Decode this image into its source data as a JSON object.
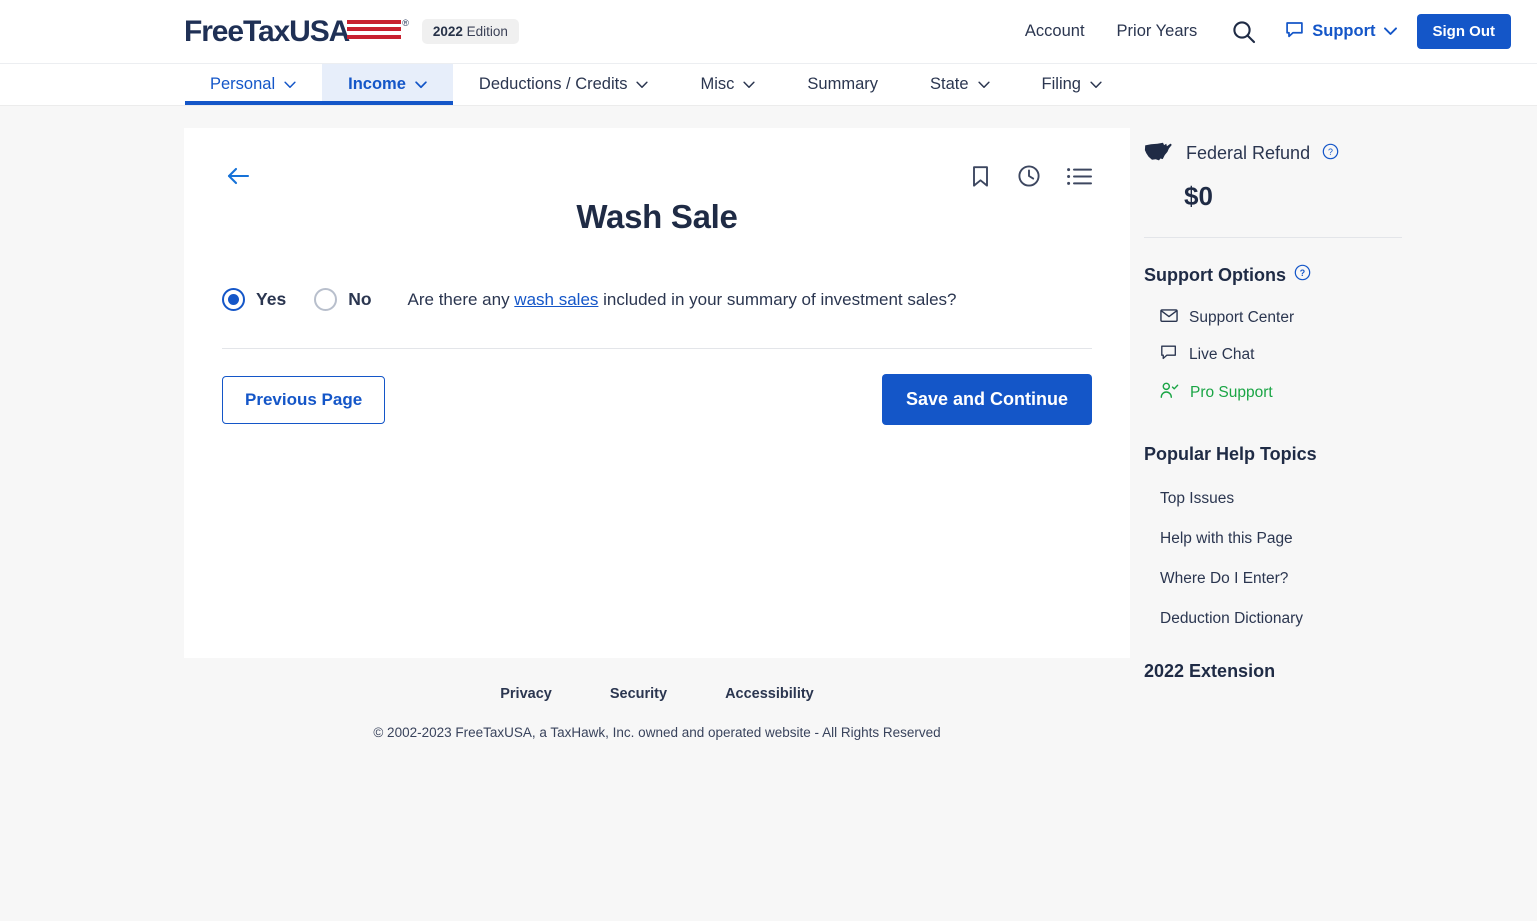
{
  "brand": {
    "name": "FreeTaxUSA",
    "registered_mark": "®",
    "edition_year": "2022",
    "edition_label": "Edition",
    "flag_color": "#c8202f",
    "logo_color": "#1f3055"
  },
  "topnav": {
    "account_label": "Account",
    "prior_years_label": "Prior Years",
    "search_icon": "search-icon",
    "chat_icon": "chat-bubble-icon",
    "support_label": "Support",
    "support_caret": "⌄",
    "sign_out_label": "Sign Out",
    "accent_color": "#1456c8"
  },
  "mainnav": {
    "tabs": [
      {
        "label": "Personal",
        "caret": "⌄",
        "state": "visited"
      },
      {
        "label": "Income",
        "caret": "⌄",
        "state": "current"
      },
      {
        "label": "Deductions / Credits",
        "caret": "⌄",
        "state": "default"
      },
      {
        "label": "Misc",
        "caret": "⌄",
        "state": "default"
      },
      {
        "label": "Summary",
        "caret": "",
        "state": "default"
      },
      {
        "label": "State",
        "caret": "⌄",
        "state": "default"
      },
      {
        "label": "Filing",
        "caret": "⌄",
        "state": "default"
      }
    ]
  },
  "card": {
    "back_icon": "back-arrow-icon",
    "icons": [
      {
        "name": "bookmark-icon"
      },
      {
        "name": "history-clock-icon"
      },
      {
        "name": "list-menu-icon"
      }
    ],
    "title": "Wash Sale",
    "question": {
      "options": [
        {
          "label": "Yes",
          "selected": true
        },
        {
          "label": "No",
          "selected": false
        }
      ],
      "text_before": "Are there any ",
      "link_text": "wash sales",
      "text_after": " included in your summary of investment sales?"
    },
    "previous_button": "Previous Page",
    "save_button": "Save and Continue"
  },
  "footer": {
    "links": [
      "Privacy",
      "Security",
      "Accessibility"
    ],
    "copyright": "© 2002-2023 FreeTaxUSA, a TaxHawk, Inc. owned and operated website - All Rights Reserved"
  },
  "sidebar": {
    "refund": {
      "map_icon": "us-map-icon",
      "label": "Federal Refund",
      "help_icon": "help-circle-icon",
      "amount": "$0"
    },
    "support_options": {
      "heading": "Support Options",
      "help_icon": "help-circle-icon",
      "items": [
        {
          "label": "Support Center",
          "icon": "envelope-icon",
          "color": "#2b3650"
        },
        {
          "label": "Live Chat",
          "icon": "chat-bubble-icon",
          "color": "#2b3650"
        },
        {
          "label": "Pro Support",
          "icon": "person-check-icon",
          "color": "#1aa545"
        }
      ]
    },
    "popular_help": {
      "heading": "Popular Help Topics",
      "items": [
        "Top Issues",
        "Help with this Page",
        "Where Do I Enter?",
        "Deduction Dictionary"
      ]
    },
    "extension": {
      "heading": "2022 Extension"
    }
  }
}
